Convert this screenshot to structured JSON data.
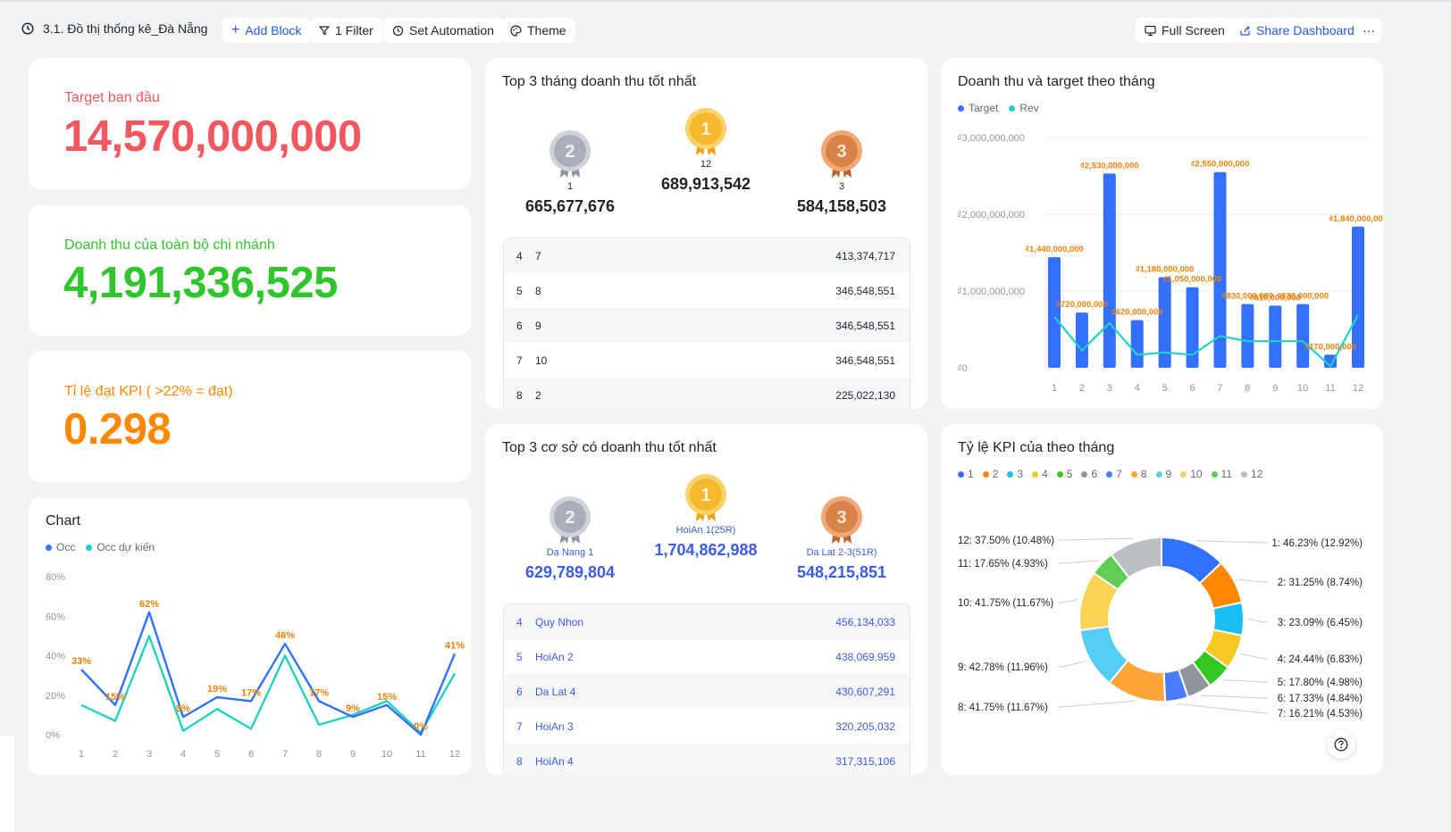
{
  "toolbar": {
    "title": "3.1. Đồ thị thống kê_Đà Nẵng",
    "add_block": "Add Block",
    "filter": "1 Filter",
    "set_automation": "Set Automation",
    "theme": "Theme",
    "full_screen": "Full Screen",
    "share_dashboard": "Share Dashboard",
    "more": "···"
  },
  "kpis": [
    {
      "label": "Target ban đầu",
      "value": "14,570,000,000",
      "color": "#f0575e"
    },
    {
      "label": "Doanh thu của toàn bộ chi nhánh",
      "value": "4,191,336,525",
      "color": "#31c52d"
    },
    {
      "label": "Tỉ lệ đạt KPI ( >22% = đạt)",
      "value": "0.298",
      "color": "#ff8800"
    }
  ],
  "top_months": {
    "title": "Top 3 tháng doanh thu tốt nhất",
    "podium": [
      {
        "rank": "2",
        "label": "1",
        "value": "665,677,676"
      },
      {
        "rank": "1",
        "label": "12",
        "value": "689,913,542"
      },
      {
        "rank": "3",
        "label": "3",
        "value": "584,158,503"
      }
    ],
    "rows": [
      {
        "rank": "4",
        "name": "7",
        "value": "413,374,717"
      },
      {
        "rank": "5",
        "name": "8",
        "value": "346,548,551"
      },
      {
        "rank": "6",
        "name": "9",
        "value": "346,548,551"
      },
      {
        "rank": "7",
        "name": "10",
        "value": "346,548,551"
      },
      {
        "rank": "8",
        "name": "2",
        "value": "225,022,130"
      }
    ]
  },
  "top_branches": {
    "title": "Top 3 cơ sở có doanh thu tốt nhất",
    "podium": [
      {
        "rank": "2",
        "label": "Da Nang 1",
        "value": "629,789,804"
      },
      {
        "rank": "1",
        "label": "HoiAn 1(25R)",
        "value": "1,704,862,988"
      },
      {
        "rank": "3",
        "label": "Da Lat 2-3(51R)",
        "value": "548,215,851"
      }
    ],
    "rows": [
      {
        "rank": "4",
        "name": "Quy Nhon",
        "value": "456,134,033"
      },
      {
        "rank": "5",
        "name": "HoiAn 2",
        "value": "438,069,959"
      },
      {
        "rank": "6",
        "name": "Da Lat 4",
        "value": "430,607,291"
      },
      {
        "rank": "7",
        "name": "HoiAn 3",
        "value": "320,205,032"
      },
      {
        "rank": "8",
        "name": "HoiAn 4",
        "value": "317,315,106"
      }
    ]
  },
  "occ_card": {
    "title": "Chart"
  },
  "revenue_card": {
    "title": "Doanh thu và target theo tháng"
  },
  "kpi_pie_card": {
    "title": "Tỷ lệ KPI của theo tháng"
  },
  "colors": {
    "gold": "#f5b82e",
    "silver": "#a9afb8",
    "bronze": "#d9834a",
    "primary_blue": "#3370ff",
    "teal": "#1fd1c4",
    "label_orange": "#f0820a"
  },
  "chart_data": [
    {
      "type": "line",
      "title": "Chart",
      "x": [
        "1",
        "2",
        "3",
        "4",
        "5",
        "6",
        "7",
        "8",
        "9",
        "10",
        "11",
        "12"
      ],
      "y_ticks": [
        "0%",
        "20%",
        "40%",
        "60%",
        "80%"
      ],
      "ylim": [
        0,
        80
      ],
      "legend_position": "top-left",
      "series": [
        {
          "name": "Occ",
          "color": "#3370ff",
          "values": [
            33,
            15,
            62,
            9,
            19,
            17,
            46,
            17,
            9,
            15,
            0,
            41
          ],
          "data_labels": [
            "33%",
            "15%",
            "62%",
            "9%",
            "19%",
            "17%",
            "46%",
            "17%",
            "9%",
            "15%",
            "0%",
            "41%"
          ]
        },
        {
          "name": "Occ dự kiến",
          "color": "#1fd1c4",
          "values": [
            15,
            7,
            50,
            2,
            13,
            3,
            40,
            5,
            10,
            17,
            1,
            31
          ]
        }
      ]
    },
    {
      "type": "bar",
      "title": "Doanh thu và target theo tháng",
      "categories": [
        "1",
        "2",
        "3",
        "4",
        "5",
        "6",
        "7",
        "8",
        "9",
        "10",
        "11",
        "12"
      ],
      "y_ticks": [
        "₫0",
        "₫1,000,000,000",
        "₫2,000,000,000",
        "₫3,000,000,000"
      ],
      "ylim": [
        0,
        3000000000
      ],
      "legend_position": "top-left",
      "series": [
        {
          "name": "Target",
          "kind": "bar",
          "color": "#3370ff",
          "values": [
            1440000000,
            720000000,
            2530000000,
            620000000,
            1180000000,
            1050000000,
            2550000000,
            830000000,
            810000000,
            830000000,
            170000000,
            1840000000
          ],
          "data_labels": [
            "₫1,440,000,000",
            "₫720,000,000",
            "₫2,530,000,000",
            "₫620,000,000",
            "₫1,180,000,000",
            "₫1,050,000,000",
            "₫2,550,000,000",
            "₫830,000,000",
            "₫810,000,000",
            "₫830,000,000",
            "₫170,000,000",
            "₫1,840,000,000"
          ]
        },
        {
          "name": "Rev",
          "kind": "line",
          "color": "#1fd1c4",
          "values": [
            665677676,
            225022130,
            584158503,
            170000000,
            200000000,
            170000000,
            413374717,
            346548551,
            346548551,
            346548551,
            20000000,
            689913542
          ]
        }
      ]
    },
    {
      "type": "pie",
      "title": "Tỷ lệ KPI của theo tháng",
      "legend_position": "top-left",
      "slices": [
        {
          "name": "1",
          "value": 12.92,
          "color": "#3370ff",
          "label": "1: 46.23% (12.92%)"
        },
        {
          "name": "2",
          "value": 8.74,
          "color": "#ff8800",
          "label": "2: 31.25% (8.74%)"
        },
        {
          "name": "3",
          "value": 6.45,
          "color": "#1bbdf4",
          "label": "3: 23.09% (6.45%)"
        },
        {
          "name": "4",
          "value": 6.83,
          "color": "#f7c925",
          "label": "4: 24.44% (6.83%)"
        },
        {
          "name": "5",
          "value": 4.98,
          "color": "#34c724",
          "label": "5: 17.80% (4.98%)"
        },
        {
          "name": "6",
          "value": 4.84,
          "color": "#8f959e",
          "label": "6: 17.33% (4.84%)"
        },
        {
          "name": "7",
          "value": 4.53,
          "color": "#4a7bff",
          "label": "7: 16.21% (4.53%)"
        },
        {
          "name": "8",
          "value": 11.67,
          "color": "#ffa53a",
          "label": "8: 41.75% (11.67%)"
        },
        {
          "name": "9",
          "value": 11.96,
          "color": "#56cdf5",
          "label": "9: 42.78% (11.96%)"
        },
        {
          "name": "10",
          "value": 11.67,
          "color": "#fad355",
          "label": "10: 41.75% (11.67%)"
        },
        {
          "name": "11",
          "value": 4.93,
          "color": "#5ecf52",
          "label": "11: 17.65% (4.93%)"
        },
        {
          "name": "12",
          "value": 10.48,
          "color": "#bbbfc4",
          "label": "12: 37.50% (10.48%)"
        }
      ]
    }
  ]
}
